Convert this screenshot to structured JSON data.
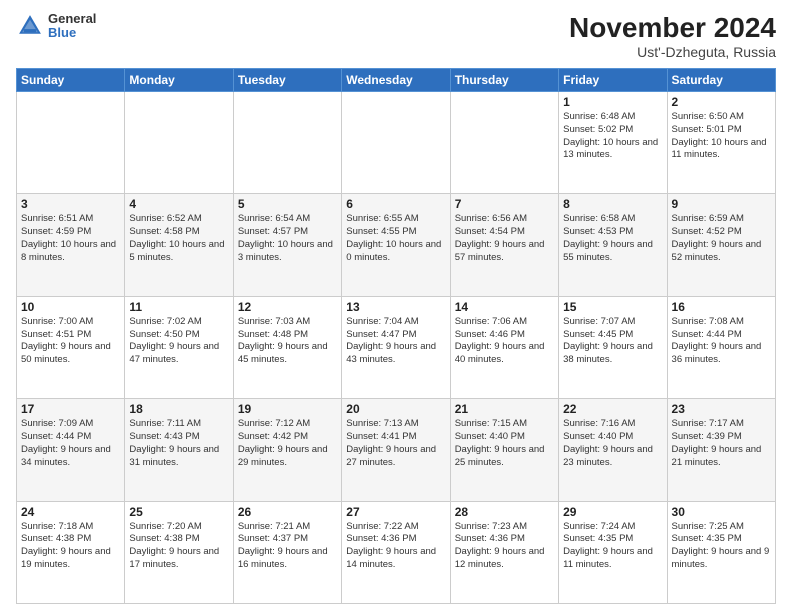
{
  "header": {
    "logo_general": "General",
    "logo_blue": "Blue",
    "title": "November 2024",
    "subtitle": "Ust'-Dzheguta, Russia"
  },
  "days_of_week": [
    "Sunday",
    "Monday",
    "Tuesday",
    "Wednesday",
    "Thursday",
    "Friday",
    "Saturday"
  ],
  "weeks": [
    [
      {
        "day": "",
        "info": ""
      },
      {
        "day": "",
        "info": ""
      },
      {
        "day": "",
        "info": ""
      },
      {
        "day": "",
        "info": ""
      },
      {
        "day": "",
        "info": ""
      },
      {
        "day": "1",
        "info": "Sunrise: 6:48 AM\nSunset: 5:02 PM\nDaylight: 10 hours and 13 minutes."
      },
      {
        "day": "2",
        "info": "Sunrise: 6:50 AM\nSunset: 5:01 PM\nDaylight: 10 hours and 11 minutes."
      }
    ],
    [
      {
        "day": "3",
        "info": "Sunrise: 6:51 AM\nSunset: 4:59 PM\nDaylight: 10 hours and 8 minutes."
      },
      {
        "day": "4",
        "info": "Sunrise: 6:52 AM\nSunset: 4:58 PM\nDaylight: 10 hours and 5 minutes."
      },
      {
        "day": "5",
        "info": "Sunrise: 6:54 AM\nSunset: 4:57 PM\nDaylight: 10 hours and 3 minutes."
      },
      {
        "day": "6",
        "info": "Sunrise: 6:55 AM\nSunset: 4:55 PM\nDaylight: 10 hours and 0 minutes."
      },
      {
        "day": "7",
        "info": "Sunrise: 6:56 AM\nSunset: 4:54 PM\nDaylight: 9 hours and 57 minutes."
      },
      {
        "day": "8",
        "info": "Sunrise: 6:58 AM\nSunset: 4:53 PM\nDaylight: 9 hours and 55 minutes."
      },
      {
        "day": "9",
        "info": "Sunrise: 6:59 AM\nSunset: 4:52 PM\nDaylight: 9 hours and 52 minutes."
      }
    ],
    [
      {
        "day": "10",
        "info": "Sunrise: 7:00 AM\nSunset: 4:51 PM\nDaylight: 9 hours and 50 minutes."
      },
      {
        "day": "11",
        "info": "Sunrise: 7:02 AM\nSunset: 4:50 PM\nDaylight: 9 hours and 47 minutes."
      },
      {
        "day": "12",
        "info": "Sunrise: 7:03 AM\nSunset: 4:48 PM\nDaylight: 9 hours and 45 minutes."
      },
      {
        "day": "13",
        "info": "Sunrise: 7:04 AM\nSunset: 4:47 PM\nDaylight: 9 hours and 43 minutes."
      },
      {
        "day": "14",
        "info": "Sunrise: 7:06 AM\nSunset: 4:46 PM\nDaylight: 9 hours and 40 minutes."
      },
      {
        "day": "15",
        "info": "Sunrise: 7:07 AM\nSunset: 4:45 PM\nDaylight: 9 hours and 38 minutes."
      },
      {
        "day": "16",
        "info": "Sunrise: 7:08 AM\nSunset: 4:44 PM\nDaylight: 9 hours and 36 minutes."
      }
    ],
    [
      {
        "day": "17",
        "info": "Sunrise: 7:09 AM\nSunset: 4:44 PM\nDaylight: 9 hours and 34 minutes."
      },
      {
        "day": "18",
        "info": "Sunrise: 7:11 AM\nSunset: 4:43 PM\nDaylight: 9 hours and 31 minutes."
      },
      {
        "day": "19",
        "info": "Sunrise: 7:12 AM\nSunset: 4:42 PM\nDaylight: 9 hours and 29 minutes."
      },
      {
        "day": "20",
        "info": "Sunrise: 7:13 AM\nSunset: 4:41 PM\nDaylight: 9 hours and 27 minutes."
      },
      {
        "day": "21",
        "info": "Sunrise: 7:15 AM\nSunset: 4:40 PM\nDaylight: 9 hours and 25 minutes."
      },
      {
        "day": "22",
        "info": "Sunrise: 7:16 AM\nSunset: 4:40 PM\nDaylight: 9 hours and 23 minutes."
      },
      {
        "day": "23",
        "info": "Sunrise: 7:17 AM\nSunset: 4:39 PM\nDaylight: 9 hours and 21 minutes."
      }
    ],
    [
      {
        "day": "24",
        "info": "Sunrise: 7:18 AM\nSunset: 4:38 PM\nDaylight: 9 hours and 19 minutes."
      },
      {
        "day": "25",
        "info": "Sunrise: 7:20 AM\nSunset: 4:38 PM\nDaylight: 9 hours and 17 minutes."
      },
      {
        "day": "26",
        "info": "Sunrise: 7:21 AM\nSunset: 4:37 PM\nDaylight: 9 hours and 16 minutes."
      },
      {
        "day": "27",
        "info": "Sunrise: 7:22 AM\nSunset: 4:36 PM\nDaylight: 9 hours and 14 minutes."
      },
      {
        "day": "28",
        "info": "Sunrise: 7:23 AM\nSunset: 4:36 PM\nDaylight: 9 hours and 12 minutes."
      },
      {
        "day": "29",
        "info": "Sunrise: 7:24 AM\nSunset: 4:35 PM\nDaylight: 9 hours and 11 minutes."
      },
      {
        "day": "30",
        "info": "Sunrise: 7:25 AM\nSunset: 4:35 PM\nDaylight: 9 hours and 9 minutes."
      }
    ]
  ]
}
